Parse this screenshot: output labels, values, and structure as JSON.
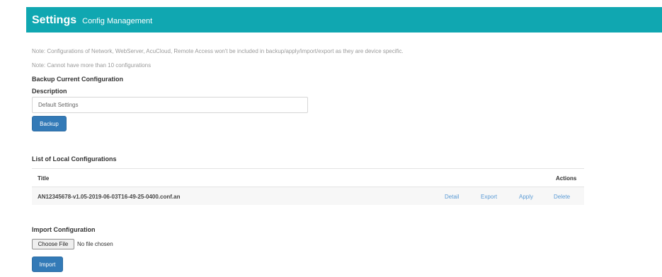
{
  "header": {
    "title": "Settings",
    "subtitle": "Config Management"
  },
  "notes": {
    "specific": "Note: Configurations of Network, WebServer, AcuCloud, Remote Access won't be included in backup/apply/import/export as they are device specific.",
    "limit": "Note: Cannot have more than 10 configurations"
  },
  "backup": {
    "heading": "Backup Current Configuration",
    "description_label": "Description",
    "description_value": "Default Settings",
    "button_label": "Backup"
  },
  "local_configs": {
    "heading": "List of Local Configurations",
    "columns": {
      "title": "Title",
      "actions": "Actions"
    },
    "rows": [
      {
        "title": "AN12345678-v1.05-2019-06-03T16-49-25-0400.conf.an",
        "actions": [
          "Detail",
          "Export",
          "Apply",
          "Delete"
        ]
      }
    ]
  },
  "import": {
    "heading": "Import Configuration",
    "choose_label": "Choose File",
    "file_status": "No file chosen",
    "button_label": "Import"
  },
  "colors": {
    "header_bg": "#10a7b1",
    "primary_button": "#337ab7",
    "link": "#5b9bd5"
  }
}
